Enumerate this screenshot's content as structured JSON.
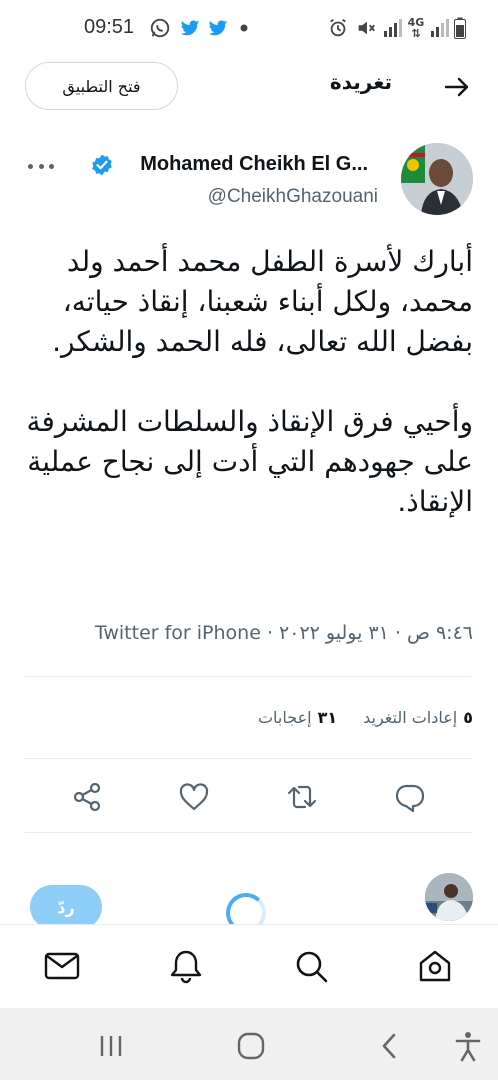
{
  "status_bar": {
    "time": "09:51",
    "icons": [
      "whatsapp-icon",
      "twitter-icon",
      "twitter-icon",
      "dot-icon",
      "alarm-icon",
      "mute-icon",
      "signal-icon",
      "4g-icon",
      "battery-icon"
    ],
    "network_label": "4G"
  },
  "header": {
    "title": "تغريدة",
    "open_app_label": "فتح التطبيق"
  },
  "tweet": {
    "author_name": "Mohamed Cheikh El G...",
    "author_handle": "@CheikhGhazouani",
    "verified": true,
    "text": "أبارك لأسرة الطفل محمد أحمد ولد محمد، ولكل أبناء شعبنا، إنقاذ حياته، بفضل الله تعالى، فله الحمد والشكر.\n\nوأحيي فرق الإنقاذ والسلطات المشرفة على جهودهم التي أدت إلى نجاح عملية الإنقاذ.",
    "meta": "٩:٤٦ ص · ٣١ يوليو ٢٠٢٢ · Twitter for iPhone",
    "stats": {
      "retweets_count": "٥",
      "retweets_label": "إعادات التغريد",
      "likes_count": "٣١",
      "likes_label": "إعجابات"
    }
  },
  "reply": {
    "button_label": "ردّ"
  },
  "colors": {
    "accent": "#1d9bf0",
    "reply_button": "#8ecdf8",
    "secondary_text": "#536471"
  }
}
